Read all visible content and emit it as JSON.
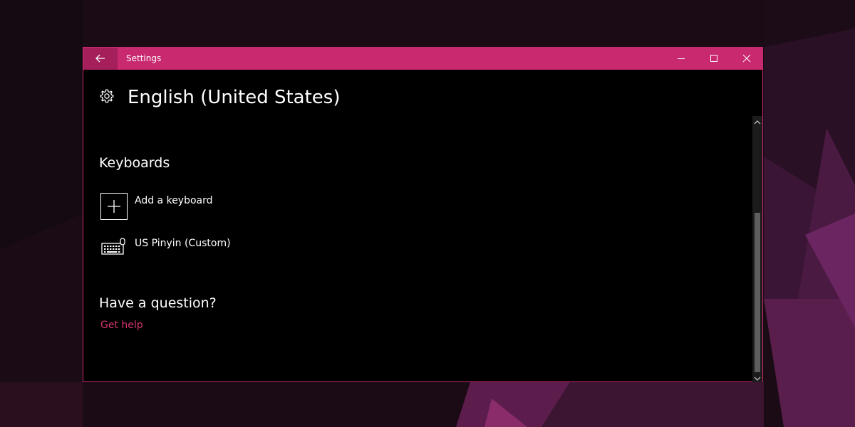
{
  "window": {
    "title": "Settings"
  },
  "page": {
    "title": "English (United States)"
  },
  "keyboards": {
    "heading": "Keyboards",
    "add_label": "Add a keyboard",
    "items": [
      {
        "label": "US Pinyin (Custom)",
        "icon": "keyboard-icon"
      }
    ]
  },
  "help": {
    "heading": "Have a question?",
    "link": "Get help"
  },
  "colors": {
    "accent": "#c8296f",
    "link": "#d5336f",
    "background": "#000000"
  }
}
